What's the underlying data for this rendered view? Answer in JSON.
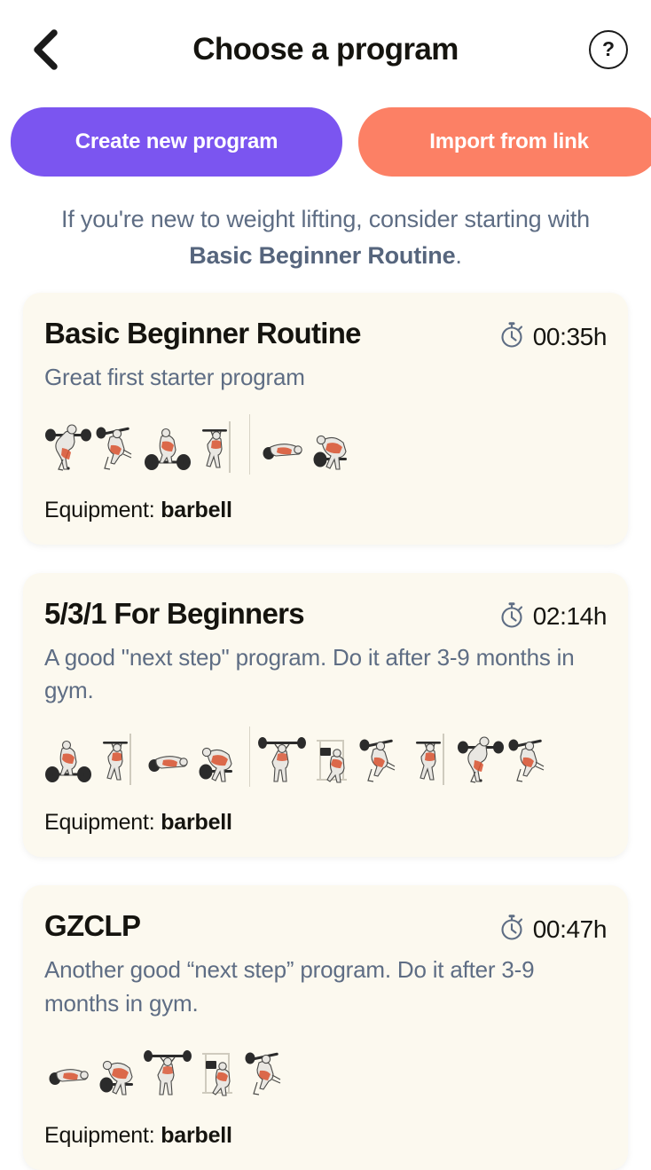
{
  "header": {
    "back_icon": "chevron-left-icon",
    "title": "Choose a program",
    "help_icon": "?",
    "help_label": "help"
  },
  "actions": {
    "create_label": "Create new program",
    "import_label": "Import from link",
    "create_color": "#7B55F0",
    "import_color": "#FC8065"
  },
  "hint": {
    "prefix": "If you're new to weight lifting, consider starting with ",
    "emphasis": "Basic Beginner Routine",
    "suffix": "."
  },
  "labels": {
    "equipment_prefix": "Equipment: ",
    "timer_icon": "stopwatch-icon"
  },
  "programs": [
    {
      "title": "Basic Beginner Routine",
      "duration": "00:35h",
      "description": "Great first starter program",
      "equipment": "barbell",
      "exercise_count": 6,
      "separator_after": 4
    },
    {
      "title": "5/3/1 For Beginners",
      "duration": "02:14h",
      "description": "A good \"next step\" program. Do it after 3-9 months in gym.",
      "equipment": "barbell",
      "exercise_count": 10,
      "separator_after": 4
    },
    {
      "title": "GZCLP",
      "duration": "00:47h",
      "description": "Another good “next step” program. Do it after 3-9 months in gym.",
      "equipment": "barbell",
      "exercise_count": 5,
      "separator_after": -1
    }
  ],
  "colors": {
    "page_background": "#FFFFFF",
    "card_background": "#FCF9EF",
    "title_text": "#15140F",
    "muted_text": "#5E6D84",
    "accent_purple": "#7B55F0",
    "accent_orange": "#FC8065"
  }
}
